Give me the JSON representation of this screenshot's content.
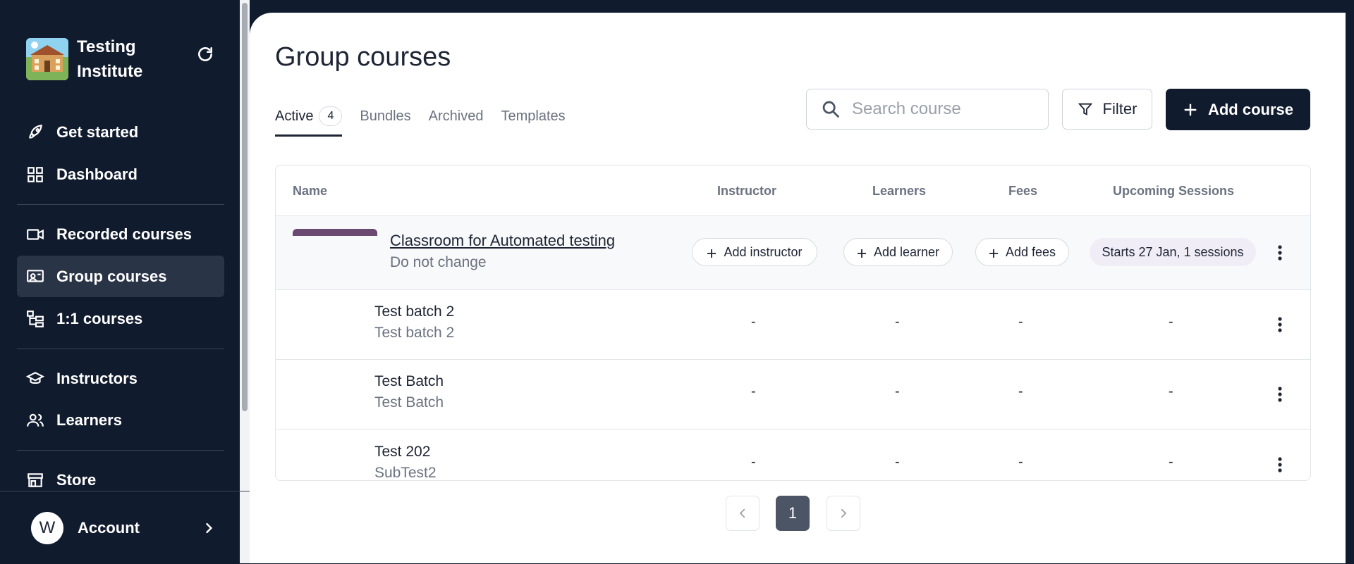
{
  "app": {
    "brand_name": "Testing Institute",
    "accent": "#111b2e"
  },
  "sidebar": {
    "items": [
      {
        "label": "Get started",
        "icon": "rocket-icon"
      },
      {
        "label": "Dashboard",
        "icon": "grid-icon"
      },
      {
        "label": "Recorded courses",
        "icon": "video-icon"
      },
      {
        "label": "Group courses",
        "icon": "classroom-icon",
        "active": true
      },
      {
        "label": "1:1 courses",
        "icon": "hierarchy-icon"
      },
      {
        "label": "Instructors",
        "icon": "graduation-cap-icon"
      },
      {
        "label": "Learners",
        "icon": "users-icon"
      },
      {
        "label": "Store",
        "icon": "store-icon"
      }
    ],
    "account": {
      "initial": "W",
      "label": "Account"
    }
  },
  "main": {
    "title": "Group courses",
    "tabs": [
      {
        "label": "Active",
        "count": "4",
        "active": true
      },
      {
        "label": "Bundles"
      },
      {
        "label": "Archived"
      },
      {
        "label": "Templates"
      }
    ],
    "search": {
      "placeholder": "Search course",
      "value": ""
    },
    "filter_label": "Filter",
    "add_course_label": "Add course"
  },
  "table": {
    "columns": [
      "Name",
      "Instructor",
      "Learners",
      "Fees",
      "Upcoming Sessions"
    ],
    "rows": [
      {
        "title": "Classroom for Automated testing",
        "subtitle": "Do not change",
        "instructor": "Add instructor",
        "learners": "Add learner",
        "fees": "Add fees",
        "sessions": "Starts 27 Jan, 1 sessions"
      },
      {
        "title": "Test batch 2",
        "subtitle": "Test batch 2",
        "instructor": "-",
        "learners": "-",
        "fees": "-",
        "sessions": "-"
      },
      {
        "title": "Test Batch",
        "subtitle": "Test Batch",
        "instructor": "-",
        "learners": "-",
        "fees": "-",
        "sessions": "-"
      },
      {
        "title": "Test 202",
        "subtitle": "SubTest2",
        "instructor": "-",
        "learners": "-",
        "fees": "-",
        "sessions": "-"
      }
    ]
  },
  "pagination": {
    "current_page": "1"
  }
}
